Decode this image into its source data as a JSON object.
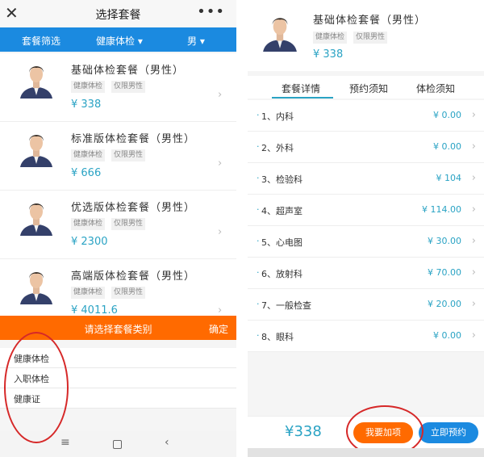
{
  "left": {
    "header": {
      "title": "选择套餐",
      "close_icon": "close-icon",
      "more_icon": "more-icon"
    },
    "filter": {
      "left": "套餐筛选",
      "middle": "健康体检 ▾",
      "right": "男 ▾"
    },
    "packages": [
      {
        "name": "基础体检套餐（男性）",
        "tags": [
          "健康体检",
          "仅限男性"
        ],
        "price": "¥ 338"
      },
      {
        "name": "标准版体检套餐（男性）",
        "tags": [
          "健康体检",
          "仅限男性"
        ],
        "price": "¥ 666"
      },
      {
        "name": "优选版体检套餐（男性）",
        "tags": [
          "健康体检",
          "仅限男性"
        ],
        "price": "¥ 2300"
      },
      {
        "name": "高端版体检套餐（男性）",
        "tags": [
          "健康体检",
          "仅限男性"
        ],
        "price": "¥ 4011.6"
      }
    ],
    "category_bar": {
      "title": "请选择套餐类别",
      "confirm": "确定"
    },
    "categories": [
      "健康体检",
      "入职体检",
      "健康证"
    ],
    "nav_icons": [
      "menu-icon",
      "home-icon",
      "back-icon"
    ]
  },
  "right": {
    "header": {
      "name": "基础体检套餐（男性）",
      "tags": [
        "健康体检",
        "仅限男性"
      ],
      "price": "¥ 338"
    },
    "tabs": [
      "套餐详情",
      "预约须知",
      "体检须知"
    ],
    "items": [
      {
        "label": "1、内科",
        "value": "¥ 0.00"
      },
      {
        "label": "2、外科",
        "value": "¥ 0.00"
      },
      {
        "label": "3、检验科",
        "value": "¥ 104"
      },
      {
        "label": "4、超声室",
        "value": "¥ 114.00"
      },
      {
        "label": "5、心电图",
        "value": "¥ 30.00"
      },
      {
        "label": "6、放射科",
        "value": "¥ 70.00"
      },
      {
        "label": "7、一般检查",
        "value": "¥ 20.00"
      },
      {
        "label": "8、眼科",
        "value": "¥ 0.00"
      }
    ],
    "bottom": {
      "total": "¥338",
      "add_button": "我要加项",
      "book_button": "立即预约"
    }
  },
  "colors": {
    "blue": "#1b8ae0",
    "orange": "#ff6a00",
    "teal": "#2aa3c4",
    "annotation_red": "#d62828"
  }
}
